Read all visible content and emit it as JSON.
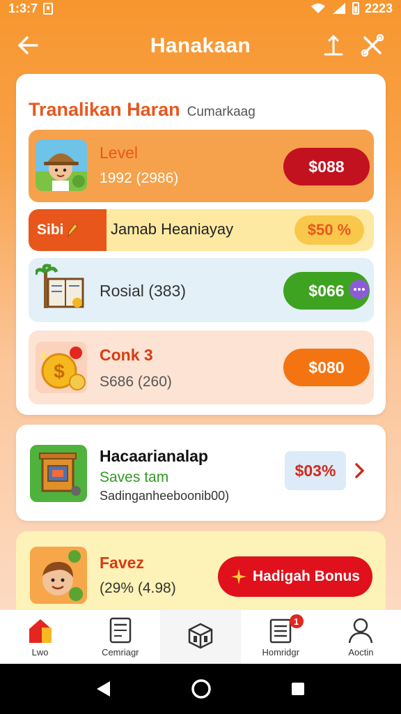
{
  "status_bar": {
    "time": "1:3:7",
    "clock": "2223"
  },
  "app_bar": {
    "title": "Hanakaan"
  },
  "main_card": {
    "title": "Tranalikan Haran",
    "subtitle": "Cumarkaag",
    "rows": [
      {
        "label": "Level",
        "sub": "1992 (2986)",
        "button": "$088",
        "color": "#c2121f"
      },
      {
        "tag": "Sibi",
        "label": "Jamab Heaniayay",
        "button": "$50 %"
      },
      {
        "label": "Rosial (383)",
        "button": "$066",
        "color": "#3fa322"
      },
      {
        "label": "Conk 3",
        "sub": "S686 (260)",
        "button": "$080",
        "color": "#f47412"
      }
    ]
  },
  "mid_card": {
    "title": "Hacaarianalap",
    "green_text": "Saves tam",
    "sub": "Sadinganheeboonib00)",
    "value": "$03%"
  },
  "bottom_card": {
    "title": "Favez",
    "sub": "(29% (4.98)",
    "button": "Hadigah Bonus"
  },
  "nav": {
    "items": [
      {
        "label": "Lwo"
      },
      {
        "label": "Cemriagr"
      },
      {
        "label": ""
      },
      {
        "label": "Homridgr",
        "badge": "1"
      },
      {
        "label": "Aoctin"
      }
    ]
  },
  "colors": {
    "accent": "#f7962e",
    "title_orange": "#e8571e",
    "red": "#c2121f",
    "green": "#3fa322"
  }
}
